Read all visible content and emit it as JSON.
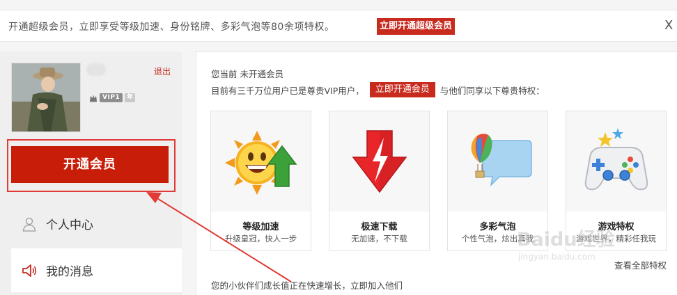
{
  "banner": {
    "text": "开通超级会员，立即享受等级加速、身份铭牌、多彩气泡等80余项特权。",
    "button_label": "立即开通超级会员",
    "close_label": "X"
  },
  "user": {
    "logout_label": "退出",
    "vip_badge": "VIP1",
    "year_badge": "年"
  },
  "sidebar": {
    "open_member_label": "开通会员",
    "items": [
      {
        "label": "个人中心",
        "icon": "person-icon"
      },
      {
        "label": "我的消息",
        "icon": "speaker-icon"
      }
    ]
  },
  "main": {
    "status_text": "您当前 未开通会员",
    "info_prefix": "目前有三千万位用户已是尊贵VIP用户，",
    "info_button": "立即开通会员",
    "info_suffix": "与他们同享以下尊贵特权：",
    "cards": [
      {
        "title": "等级加速",
        "desc": "升级皇冠，快人一步",
        "icon": "sun-arrow-icon"
      },
      {
        "title": "极速下载",
        "desc": "无加速，不下载",
        "icon": "download-arrow-icon"
      },
      {
        "title": "多彩气泡",
        "desc": "个性气泡，炫出真我",
        "icon": "balloon-bubble-icon"
      },
      {
        "title": "游戏特权",
        "desc": "游戏世界，精彩任我玩",
        "icon": "gamepad-icon"
      }
    ],
    "see_all_label": "查看全部特权",
    "bottom_text": "您的小伙伴们成长值正在快速增长，立即加入他们"
  },
  "watermark": {
    "main": "Baidu经验",
    "sub": "jingyan.baidu.com"
  },
  "colors": {
    "accent_red": "#c82a1e",
    "button_red": "#c71d09",
    "highlight_border": "#e23a34"
  }
}
